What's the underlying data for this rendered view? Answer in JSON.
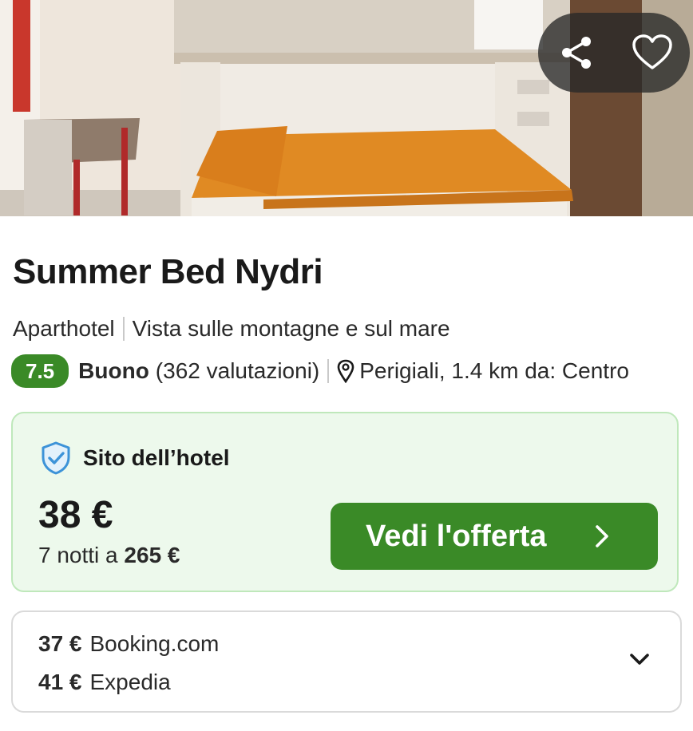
{
  "hero": {
    "share_icon": "share-icon",
    "favorite_icon": "heart-icon"
  },
  "hotel": {
    "name": "Summer Bed Nydri",
    "type": "Aparthotel",
    "view": "Vista sulle montagne e sul mare",
    "score": "7.5",
    "rating_word": "Buono",
    "reviews": "(362 valutazioni)",
    "location": "Perigiali, 1.4 km da: Centro"
  },
  "offer": {
    "provider": "Sito dell’hotel",
    "price": "38 €",
    "nights_prefix": "7 notti a",
    "total_price": "265 €",
    "cta_label": "Vedi l'offerta"
  },
  "other_offers": [
    {
      "price": "37 €",
      "site": "Booking.com"
    },
    {
      "price": "41 €",
      "site": "Expedia"
    }
  ],
  "colors": {
    "accent_green": "#3a8a27",
    "card_bg": "#edf9ec",
    "card_border": "#bfe8bb"
  }
}
